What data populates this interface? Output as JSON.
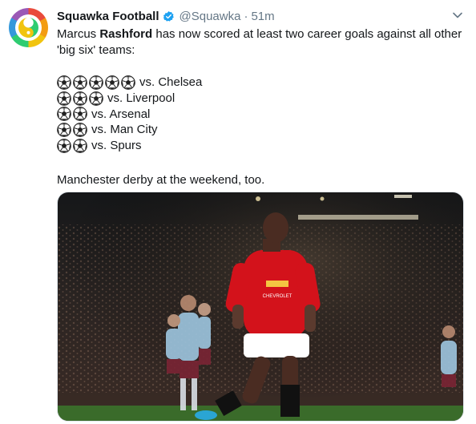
{
  "tweet": {
    "author_name": "Squawka Football",
    "handle": "@Squawka",
    "separator": "·",
    "time": "51m",
    "verified": true,
    "intro": {
      "part1": "Marcus ",
      "bold": "Rashford",
      "part2": " has now scored at least two career goals against all other",
      "line2": "'big six' teams:"
    },
    "goals": [
      {
        "team": "vs. Chelsea",
        "count": 5
      },
      {
        "team": "vs. Liverpool",
        "count": 3
      },
      {
        "team": "vs. Arsenal",
        "count": 2
      },
      {
        "team": "vs. Man City",
        "count": 2
      },
      {
        "team": "vs. Spurs",
        "count": 2
      }
    ],
    "trailer": "Manchester derby at the weekend, too.",
    "photo_description_icon": "football-celebration-photo",
    "colors": {
      "verified_badge": "#1da1f2",
      "secondary_text": "#657786",
      "primary_text": "#14171a",
      "home_kit_red": "#d3121b",
      "away_kit_claret": "#7a2434",
      "away_kit_blue": "#9ec6e0"
    }
  }
}
